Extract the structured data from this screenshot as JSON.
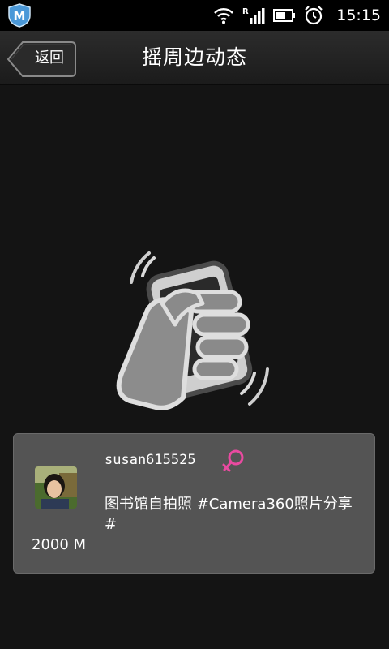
{
  "status_bar": {
    "time": "15:15",
    "icons": [
      "wifi-icon",
      "signal-icon",
      "battery-icon",
      "alarm-icon"
    ]
  },
  "header": {
    "back_label": "返回",
    "title": "摇周边动态"
  },
  "card": {
    "username": "susan615525",
    "gender": "female",
    "status_text": "图书馆自拍照 #Camera360照片分享#",
    "distance": "2000 M"
  },
  "colors": {
    "background": "#141414",
    "card_bg": "#545454",
    "gender_female": "#e94aa0"
  }
}
